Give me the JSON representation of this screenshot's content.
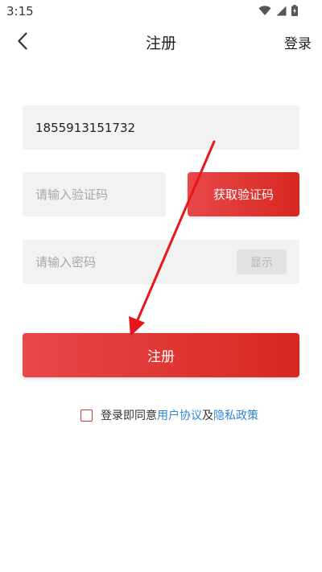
{
  "status_bar": {
    "time": "3:15",
    "icons": [
      "wifi-icon",
      "signal-icon",
      "battery-icon"
    ]
  },
  "header": {
    "title": "注册",
    "login_label": "登录",
    "back_icon": "chevron-left-icon"
  },
  "form": {
    "phone_value": "1855913151732",
    "code_placeholder": "请输入验证码",
    "get_code_label": "获取验证码",
    "password_placeholder": "请输入密码",
    "show_label": "显示",
    "register_label": "注册"
  },
  "agreement": {
    "prefix": "登录即同意",
    "user_agreement": "用户协议",
    "conjunction": "及",
    "privacy_policy": "隐私政策",
    "checked": false
  },
  "colors": {
    "accent": "#d7281f",
    "accent_light": "#e8474a",
    "link": "#2f86d6",
    "annotation_arrow": "#e8161b"
  }
}
